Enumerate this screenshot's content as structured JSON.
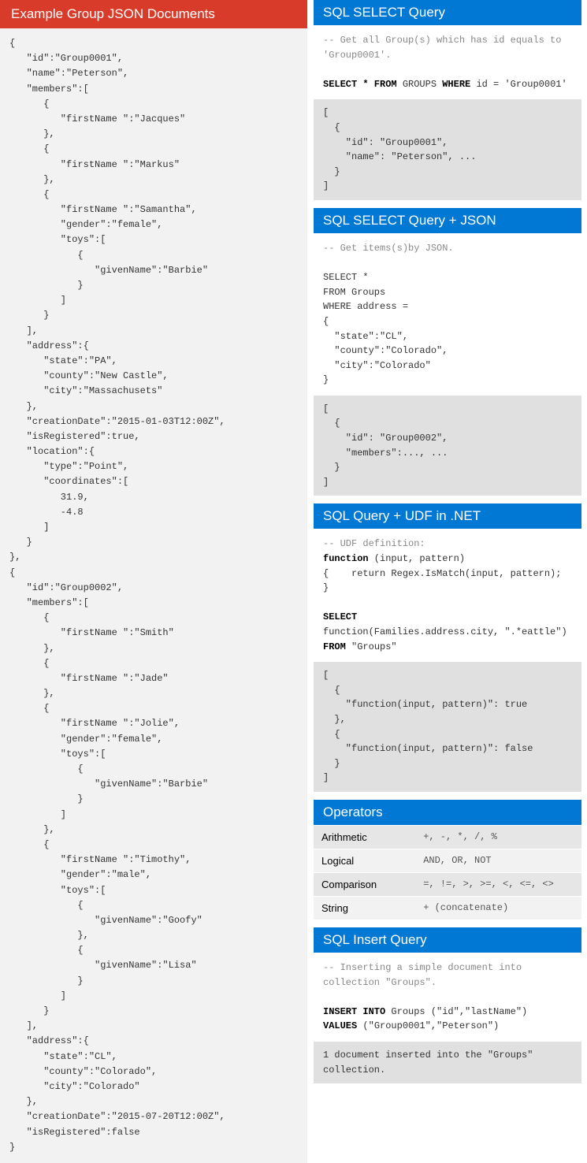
{
  "left": {
    "title": "Example Group JSON Documents",
    "json": "{\n   \"id\":\"Group0001\",\n   \"name\":\"Peterson\",\n   \"members\":[\n      {\n         \"firstName \":\"Jacques\"\n      },\n      {\n         \"firstName \":\"Markus\"\n      },\n      {\n         \"firstName \":\"Samantha\",\n         \"gender\":\"female\",\n         \"toys\":[\n            {\n               \"givenName\":\"Barbie\"\n            }\n         ]\n      }\n   ],\n   \"address\":{\n      \"state\":\"PA\",\n      \"county\":\"New Castle\",\n      \"city\":\"Massachusets\"\n   },\n   \"creationDate\":\"2015-01-03T12:00Z\",\n   \"isRegistered\":true,\n   \"location\":{\n      \"type\":\"Point\",\n      \"coordinates\":[\n         31.9,\n         -4.8\n      ]\n   }\n},\n{\n   \"id\":\"Group0002\",\n   \"members\":[\n      {\n         \"firstName \":\"Smith\"\n      },\n      {\n         \"firstName \":\"Jade\"\n      },\n      {\n         \"firstName \":\"Jolie\",\n         \"gender\":\"female\",\n         \"toys\":[\n            {\n               \"givenName\":\"Barbie\"\n            }\n         ]\n      },\n      {\n         \"firstName \":\"Timothy\",\n         \"gender\":\"male\",\n         \"toys\":[\n            {\n               \"givenName\":\"Goofy\"\n            },\n            {\n               \"givenName\":\"Lisa\"\n            }\n         ]\n      }\n   ],\n   \"address\":{\n      \"state\":\"CL\",\n      \"county\":\"Colorado\",\n      \"city\":\"Colorado\"\n   },\n   \"creationDate\":\"2015-07-20T12:00Z\",\n   \"isRegistered\":false\n}"
  },
  "select": {
    "title": "SQL SELECT Query",
    "comment": "-- Get all Group(s) which has id equals to 'Group0001'.",
    "kw1": "SELECT * FROM",
    "txt1": " GROUPS ",
    "kw2": "WHERE",
    "txt2": " id = 'Group0001'",
    "result": "[\n  {\n    \"id\": \"Group0001\",\n    \"name\": \"Peterson\", ...\n  }\n]"
  },
  "selectJson": {
    "title": "SQL SELECT Query + JSON",
    "comment": "-- Get items(s)by JSON.",
    "body": "SELECT *\nFROM Groups\nWHERE address =\n{\n  \"state\":\"CL\",\n  \"county\":\"Colorado\",\n  \"city\":\"Colorado\"\n}",
    "result": "[\n  {\n    \"id\": \"Group0002\",\n    \"members\":..., ...\n  }\n]"
  },
  "udf": {
    "title": "SQL Query + UDF in .NET",
    "comment": "-- UDF definition:",
    "kw1": "function",
    "sig": " (input, pattern)",
    "body": "{    return Regex.IsMatch(input, pattern); }",
    "kw2": "SELECT",
    "line2": "function(Families.address.city, \".*eattle\")",
    "kw3": "FROM",
    "txt3": " \"Groups\"",
    "result": "[\n  {\n    \"function(input, pattern)\": true\n  },\n  {\n    \"function(input, pattern)\": false\n  }\n]"
  },
  "operators": {
    "title": "Operators",
    "rows": [
      {
        "label": "Arithmetic",
        "value": "+, -, *, /, %"
      },
      {
        "label": "Logical",
        "value": "AND, OR, NOT"
      },
      {
        "label": "Comparison",
        "value": "=, !=, >, >=, <, <=, <>"
      },
      {
        "label": "String",
        "value": "+ (concatenate)"
      }
    ]
  },
  "insert": {
    "title": "SQL Insert Query",
    "comment": "-- Inserting a simple document into collection \"Groups\".",
    "kw1": "INSERT INTO",
    "txt1": " Groups (\"id\",\"lastName\")",
    "kw2": "VALUES",
    "txt2": " (\"Group0001\",\"Peterson\")",
    "result": "1 document inserted into the \"Groups\" collection."
  }
}
